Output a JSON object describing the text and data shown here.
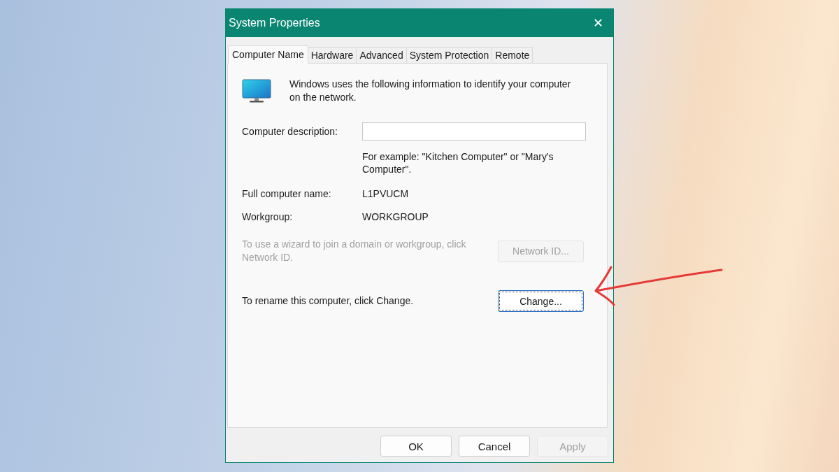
{
  "window": {
    "title": "System Properties",
    "close": "✕"
  },
  "tabs": [
    {
      "label": "Computer Name",
      "selected": true
    },
    {
      "label": "Hardware",
      "selected": false
    },
    {
      "label": "Advanced",
      "selected": false
    },
    {
      "label": "System Protection",
      "selected": false
    },
    {
      "label": "Remote",
      "selected": false
    }
  ],
  "intro": "Windows uses the following information to identify your computer on the network.",
  "description": {
    "label": "Computer description:",
    "hint": "For example: \"Kitchen Computer\" or \"Mary's Computer\"."
  },
  "fields": [
    {
      "label": "Full computer name:",
      "value": "L1PVUCM"
    },
    {
      "label": "Workgroup:",
      "value": "WORKGROUP"
    }
  ],
  "actions": [
    {
      "text": "To use a wizard to join a domain or workgroup, click Network ID.",
      "button": "Network ID...",
      "disabled": true,
      "focused": false
    },
    {
      "text": "To rename this computer, click Change.",
      "button": "Change...",
      "disabled": false,
      "focused": true
    }
  ],
  "buttons": [
    {
      "label": "OK",
      "disabled": false
    },
    {
      "label": "Cancel",
      "disabled": false
    },
    {
      "label": "Apply",
      "disabled": true
    }
  ]
}
